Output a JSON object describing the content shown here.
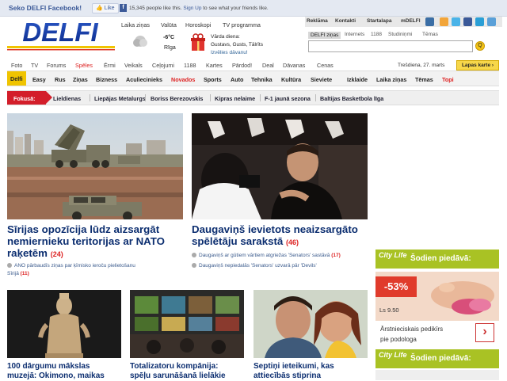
{
  "facebook": {
    "title": "Seko DELFI Facebook!",
    "like_label": "Like",
    "count_text": "15,345 people like this.",
    "signup_link": "Sign Up",
    "count_suffix": "to see what your friends like."
  },
  "top_links": [
    "Reklāma",
    "Kontakti",
    "Startalapa",
    "mDELFI"
  ],
  "logo_text": "DELFI",
  "top_nav": [
    "Laika ziņas",
    "Valūta",
    "Horoskopi",
    "TV programma"
  ],
  "weather": {
    "temp": "-6°C",
    "city": "Rīga"
  },
  "namedays": {
    "label": "Vārda diena:",
    "names": "Gustavs, Gusts, Tālrīts",
    "link": "Izvēlies dāvanu!"
  },
  "search": {
    "tabs": [
      "DELFI ziņas",
      "Internets",
      "1188",
      "Studiniņmi",
      "Tēmas"
    ],
    "placeholder": "",
    "button": "Q"
  },
  "cat_nav": [
    "Foto",
    "TV",
    "Forums",
    "Spēles",
    "Ērmi",
    "Veikals",
    "Ceļojumi",
    "1188",
    "Kartes",
    "Pārdod!",
    "Deal",
    "Dāvanas",
    "Cenas"
  ],
  "date": "Trešdiena, 27. marts",
  "map_button": "Lapas karte",
  "sections": [
    "Delfi",
    "Easy",
    "Rus",
    "Ziņas",
    "Bizness",
    "Aculiecinieks",
    "Novados",
    "Sports",
    "Auto",
    "Tehnika",
    "Kultūra",
    "Sieviete",
    "Izklaide",
    "Laika ziņas",
    "Tēmas",
    "Topi"
  ],
  "focus": {
    "label": "Fokusā:",
    "items": [
      "Lieldienas",
      "Liepājas Metalurgs",
      "Boriss Berezovskis",
      "Kipras nelaime",
      "F-1 jaunā sezona",
      "Baltijas Basketbola līga"
    ]
  },
  "main_left": {
    "title_l1": "Sīrijas opozīcija lūdz aizsargāt",
    "title_l2": "nemiernieku teritorijas ar NATO",
    "title_l3": "raķetēm",
    "count": "(24)",
    "sub_text": "ANO pārbaudīs ziņas par ķīmisko ieroču pielietošanu",
    "sub_text2": "Sīrijā",
    "sub_count": "(11)"
  },
  "main_right": {
    "title_l1": "Daugaviņš ievietots neaizsargāto",
    "title_l2": "spēlētāju sarakstā",
    "count": "(46)",
    "subs": [
      {
        "text": "Daugaviņš ar gūtiem vārtiem atgriežas 'Senators' sastāvā",
        "count": "(17)"
      },
      {
        "text": "Daugaviņš nepiedalās 'Senators' uzvarā pār 'Devils'",
        "count": ""
      }
    ]
  },
  "small_articles": [
    {
      "l1": "100 dārgumu mākslas",
      "l2": "muzejā: Okimono, maikas"
    },
    {
      "l1": "Totalizatoru kompānija:",
      "l2": "spēļu sarunāšanā lielākie"
    },
    {
      "l1": "Septiņi ieteikumi, kas",
      "l2": "attiecībās stiprina"
    }
  ],
  "ad": {
    "brand": "City Life",
    "headline": "Šodien piedāvā:",
    "discount": "-53%",
    "price": "Ls 9.50",
    "desc_l1": "Ārstnieciskais pedikīrs",
    "desc_l2": "pie podologa",
    "next": "›"
  },
  "colors": {
    "accent": "#f0c400",
    "brand_blue": "#0c2e70",
    "focus_red": "#d31e2a",
    "ad_green": "#a9c224"
  }
}
